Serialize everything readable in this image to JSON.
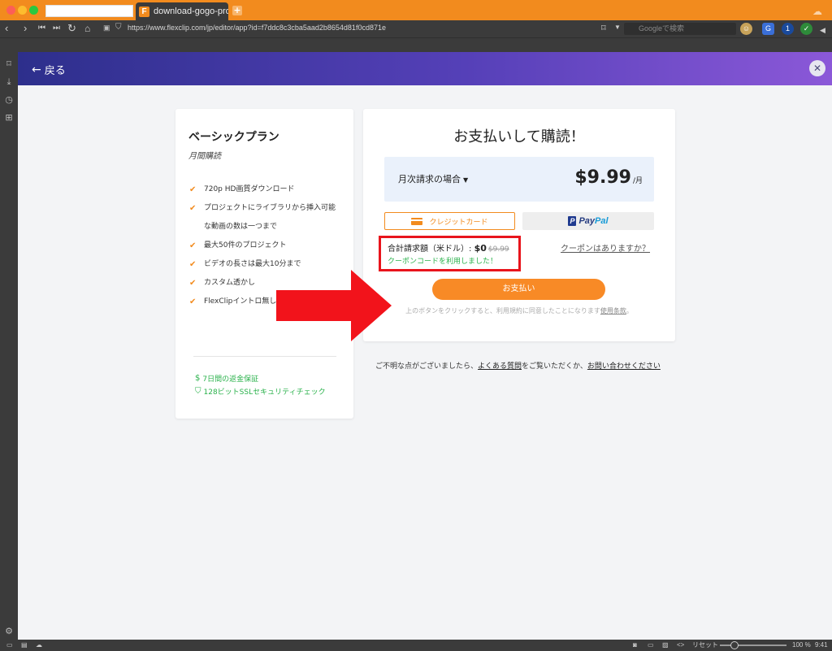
{
  "browser": {
    "active_tab_title": "download-gogo-promotio",
    "url": "https://www.flexclip.com/jp/editor/app?id=f7ddc8c3cba5aad2b8654d81f0cd871e",
    "search_placeholder": "Googleで検索",
    "status": {
      "reset_label": "リセット",
      "zoom": "100 %",
      "time": "9:41"
    }
  },
  "header": {
    "back_label": "戻る"
  },
  "plan": {
    "title": "ベーシックプラン",
    "subtitle": "月間購読",
    "features": [
      "720p HD画質ダウンロード",
      "プロジェクトにライブラリから挿入可能",
      "な動画の数は一つまで",
      "最大50件のプロジェクト",
      "ビデオの長さは最大10分まで",
      "カスタム透かし",
      "FlexClipイントロ無し"
    ],
    "guarantee": "7日間の返金保証",
    "ssl": "128ビットSSLセキュリティチェック"
  },
  "payment": {
    "title": "お支払いして購読！",
    "billing_label": "月次請求の場合",
    "price": "$9.99",
    "per": "/月",
    "method_card_label": "クレジットカード",
    "paypal_pay": "Pay",
    "paypal_pal": "Pal",
    "total_label": "合計請求額（米ドル）: ",
    "total_value": "$0",
    "total_original": "$9.99",
    "coupon_applied": "クーポンコードを利用しました！",
    "coupon_question": "クーポンはありますか？",
    "pay_button": "お支払い",
    "terms_text": "上のボタンをクリックすると、利用規約に同意したことになります",
    "terms_link": "使用条款",
    "terms_end": "。"
  },
  "help": {
    "prefix": "ご不明な点がございましたら、",
    "faq": "よくある質問",
    "middle": "をご覧いただくか、",
    "contact": "お問い合わせください"
  },
  "colors": {
    "accent": "#f28b1e",
    "success": "#2bb24c",
    "annotation": "#e8141c"
  }
}
